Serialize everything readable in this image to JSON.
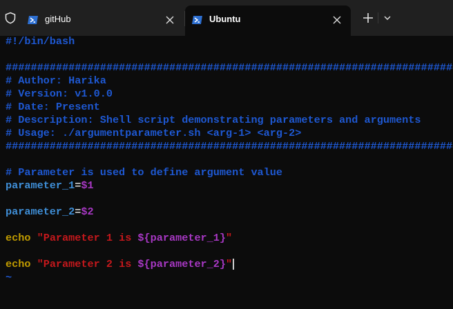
{
  "tabs": [
    {
      "label": "gitHub",
      "active": false,
      "icon": "powershell-icon"
    },
    {
      "label": "Ubuntu",
      "active": true,
      "icon": "powershell-icon"
    }
  ],
  "toolbar": {
    "new_tab": "+",
    "dropdown": "chevron-down-icon"
  },
  "colors": {
    "comment": "#1e58d2",
    "variable": "#3f8fd8",
    "parameter": "#a838c4",
    "keyword_echo": "#c19c00",
    "string": "#c5181c"
  },
  "editor": {
    "shebang": "#!/bin/bash",
    "hash_line": "#########################################################################",
    "author": "# Author: Harika",
    "version": "# Version: v1.0.0",
    "date": "# Date: Present",
    "description": "# Description: Shell script demonstrating parameters and arguments",
    "usage": "# Usage: ./argumentparameter.sh <arg-1> <arg-2>",
    "param_comment": "# Parameter is used to define argument value",
    "p1_name": "parameter_1",
    "p1_value": "$1",
    "p2_name": "parameter_2",
    "p2_value": "$2",
    "echo_kw": "echo",
    "echo1_text": "\"Parameter 1 is ",
    "echo1_var": "${parameter_1}",
    "echo1_end": "\"",
    "echo2_text": "\"Parameter 2 is ",
    "echo2_var": "${parameter_2}",
    "echo2_end": "\"",
    "eq": "=",
    "tilde": "~"
  }
}
